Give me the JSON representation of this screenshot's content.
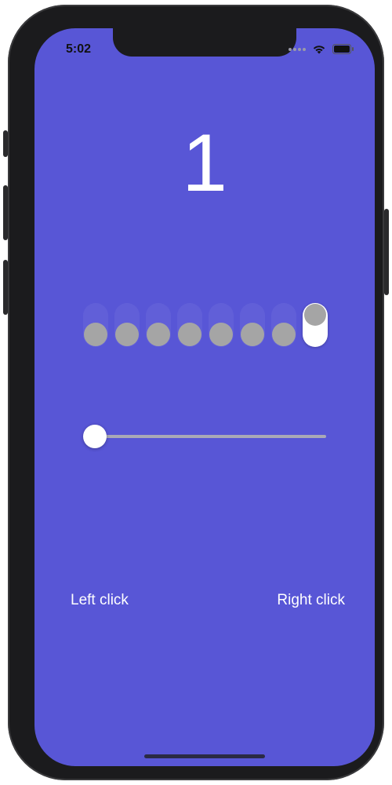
{
  "status_bar": {
    "time": "5:02",
    "wifi_icon": "wifi-icon",
    "battery_icon": "battery-icon"
  },
  "counter": {
    "value": "1"
  },
  "switches": {
    "count": 8,
    "states": [
      false,
      false,
      false,
      false,
      false,
      false,
      false,
      true
    ]
  },
  "slider": {
    "value": 0
  },
  "buttons": {
    "left_click": "Left click",
    "right_click": "Right click"
  },
  "colors": {
    "background": "#5856d6",
    "knob": "#a5a5a5",
    "on_track": "#ffffff",
    "text": "#ffffff"
  }
}
